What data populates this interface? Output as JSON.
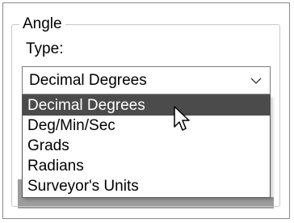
{
  "group": {
    "title": "Angle"
  },
  "type_field": {
    "label": "Type:",
    "selected_value": "Decimal Degrees",
    "options": [
      "Decimal Degrees",
      "Deg/Min/Sec",
      "Grads",
      "Radians",
      "Surveyor's Units"
    ],
    "highlighted_option": "Decimal Degrees"
  },
  "icons": {
    "dropdown": "chevron-down-icon",
    "cursor": "mouse-pointer-icon"
  },
  "colors": {
    "highlight_bg": "#4b4b4b",
    "highlight_text": "#ffffff",
    "border": "#7a7a7a"
  }
}
